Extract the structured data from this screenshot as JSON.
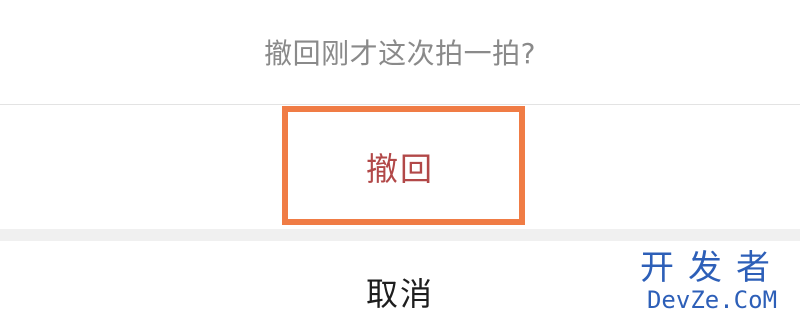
{
  "dialog": {
    "prompt": "撤回刚才这次拍一拍?",
    "action_label": "撤回",
    "cancel_label": "取消"
  },
  "highlight": {
    "color": "#f07c45"
  },
  "watermark": {
    "cn": "开发者",
    "en": "DevZe.CoM",
    "color": "#2d5fb8"
  }
}
